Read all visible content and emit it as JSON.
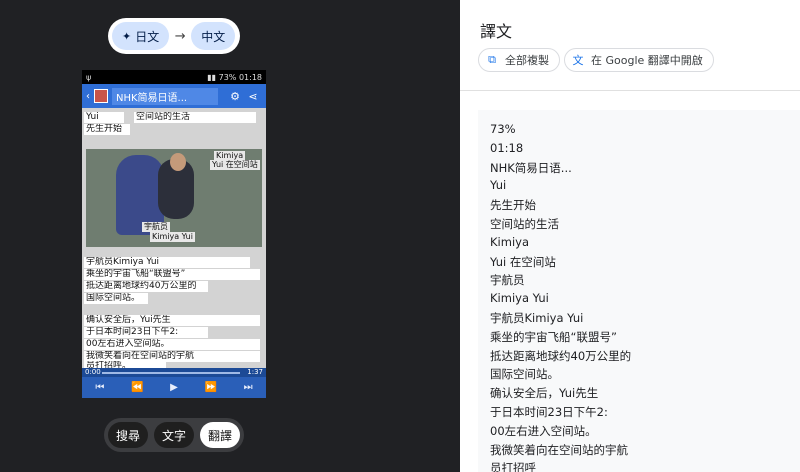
{
  "lang": {
    "source": "日文",
    "target": "中文",
    "arrow": "→"
  },
  "phone": {
    "status_battery": "73%",
    "status_time": "01:18",
    "app_title": "NHK简易日语...",
    "lines": {
      "l1a": "Yui",
      "l1b": "空间站的生活",
      "l2": "先生开始",
      "l3": "宇航员Kimiya Yui",
      "l4": "乘坐的宇宙飞船“联盟号”",
      "l5": " 抵达距离地球约40万公里的",
      "l6": "国际空间站。",
      "l7": "确认安全后，Yui先生",
      "l8": "于日本时间23日下午2:",
      "l9": "00左右进入空间站。",
      "l10": "我微笑着向在空间站的宇航",
      "l11": "员打招呼。"
    },
    "photo_labels": {
      "kimiya": "Kimiya",
      "yui_station": "Yui 在空间站",
      "astronaut": "宇航员",
      "kimiya_yui": "Kimiya Yui"
    },
    "player": {
      "elapsed": "0:00",
      "total": "1:37",
      "progress": 0.0
    }
  },
  "modes": {
    "search": "搜尋",
    "text": "文字",
    "translate": "翻譯",
    "active": "translate"
  },
  "result": {
    "title": "譯文",
    "copy_all": "全部複製",
    "open_in_translate": "在 Google 翻譯中開啟",
    "lines": [
      "73%",
      "01:18",
      "NHK简易日语...",
      "Yui",
      "先生开始",
      "空间站的生活",
      "Kimiya",
      "Yui 在空间站",
      "宇航员",
      "Kimiya Yui",
      "宇航员Kimiya Yui",
      "乘坐的宇宙飞船“联盟号”",
      "抵达距离地球约40万公里的",
      "国际空间站。",
      "确认安全后，Yui先生",
      "于日本时间23日下午2:",
      "00左右进入空间站。",
      "我微笑着向在空间站的宇航",
      "员打招呼"
    ]
  },
  "colors": {
    "accent": "#1a73e8",
    "app_bar": "#2f6ed6",
    "chip": "#d3e3fd"
  }
}
